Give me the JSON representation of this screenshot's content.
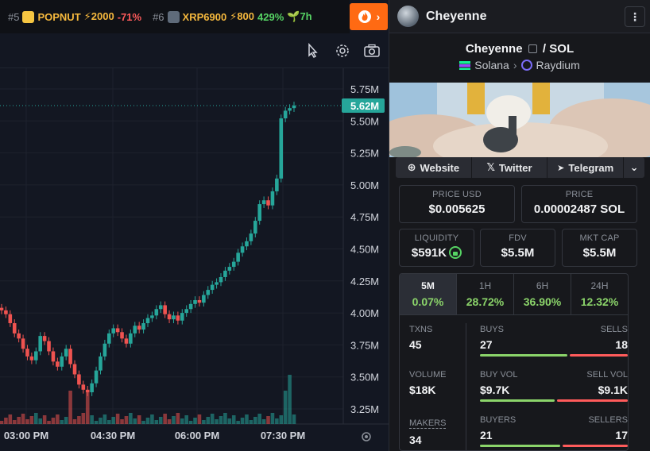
{
  "ticker": [
    {
      "rank": "#5",
      "symbol": "POPNUT",
      "boost": "⚡2000",
      "change": "-71%",
      "change_type": "neg",
      "icon": "popcorn-icon",
      "icon_color": "#f5c542"
    },
    {
      "rank": "#6",
      "symbol": "XRP6900",
      "boost": "⚡800",
      "change": "429%",
      "change_type": "pos",
      "age": "7h",
      "icon": "coin-icon",
      "icon_color": "#5f6b7a"
    }
  ],
  "chart": {
    "price_labels": [
      "5.75M",
      "5.50M",
      "5.25M",
      "5.00M",
      "4.75M",
      "4.50M",
      "4.25M",
      "4.00M",
      "3.75M",
      "3.50M",
      "3.25M"
    ],
    "current_price": "5.62M",
    "time_labels": [
      "03:00 PM",
      "04:30 PM",
      "06:00 PM",
      "07:30 PM"
    ],
    "up_color": "#26a69a",
    "down_color": "#ef5350"
  },
  "panel": {
    "token_name": "Cheyenne",
    "pair_base": "Cheyenne",
    "pair_quote": "SOL",
    "chain": "Solana",
    "dex": "Raydium",
    "links": {
      "website": "Website",
      "twitter": "Twitter",
      "telegram": "Telegram"
    },
    "price_usd_label": "PRICE USD",
    "price_usd": "$0.005625",
    "price_label": "PRICE",
    "price_native": "0.00002487 SOL",
    "liquidity_label": "LIQUIDITY",
    "liquidity": "$591K",
    "fdv_label": "FDV",
    "fdv": "$5.5M",
    "mktcap_label": "MKT CAP",
    "mktcap": "$5.5M",
    "periods": [
      {
        "label": "5M",
        "value": "0.07%",
        "active": true
      },
      {
        "label": "1H",
        "value": "28.72%",
        "active": false
      },
      {
        "label": "6H",
        "value": "36.90%",
        "active": false
      },
      {
        "label": "24H",
        "value": "12.32%",
        "active": false
      }
    ],
    "txns_label": "TXNS",
    "txns": "45",
    "volume_label": "VOLUME",
    "volume": "$18K",
    "makers_label": "MAKERS",
    "makers": "34",
    "buys_label": "BUYS",
    "buys": "27",
    "sells_label": "SELLS",
    "sells": "18",
    "buy_vol_label": "BUY VOL",
    "buy_vol": "$9.7K",
    "sell_vol_label": "SELL VOL",
    "sell_vol": "$9.1K",
    "buyers_label": "BUYERS",
    "buyers": "21",
    "sellers_label": "SELLERS",
    "sellers": "17"
  }
}
